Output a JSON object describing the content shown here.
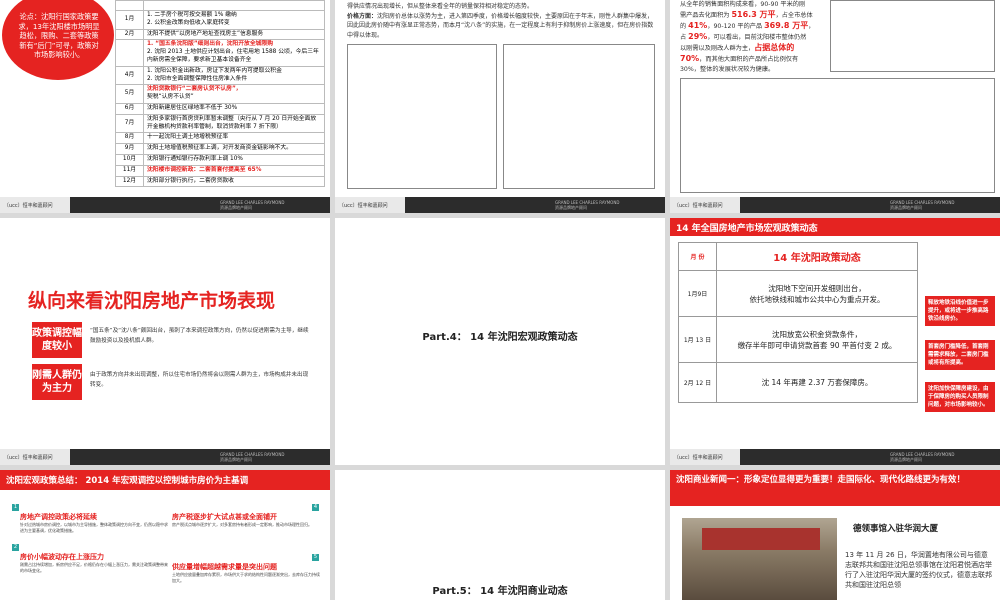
{
  "slide1": {
    "oval_text": "论点：沈阳行国家政策要求，13年沈阳楼市场明显趋松，限购、二套等政策新有“后门”可寻，政策对市场影响较小。",
    "rows": [
      {
        "month": "",
        "text": ""
      },
      {
        "month": "1月",
        "text": "1. 二手房个税可按交易额 1% 缴纳\n2. 公积金改策向低收入家庭转变"
      },
      {
        "month": "2月",
        "text": "沈阳不提供“以房地产地址查找房主”信息服务"
      },
      {
        "month": "",
        "text_red": "1. “国五条沈阳版”细则出台，沈阳开放全城限购",
        "text": "2. 沈阳 2013 土地供应计划出台，住宅用地 1588 公顷，今后三年内新房需全保障，要求新卫基本设备齐全"
      },
      {
        "month": "4月",
        "text": "1. 沈阳公积金出新政，房证下发两年内可提取公积金\n2. 沈阳市全面调整保障性住房准入条件"
      },
      {
        "month": "5月",
        "text_red": "沈阳贷款银行“二套房认贷不认房”，",
        "text": "契税“认房不认贷”"
      },
      {
        "month": "6月",
        "text": "沈阳新建居住区绿地率不低于 30%"
      },
      {
        "month": "7月",
        "text": "沈阳多家银行首房贷利率暂未调整（央行从 7 月 20 日开始全面放开金融机构贷款利率管制，取消贷款利率 7 折下限）"
      },
      {
        "month": "8月",
        "text": "十一起沈阳土调土地增税预征率"
      },
      {
        "month": "9月",
        "text": "沈阳土地增值税预征率上调，对开发商资金链影响不大。"
      },
      {
        "month": "10月",
        "text": "沈阳银行通知银行存款利率上调 10%"
      },
      {
        "month": "11月",
        "text_red": "沈阳楼市调控新政：二套首套付提高至 65%",
        "text": ""
      },
      {
        "month": "12月",
        "text": "沈阳部分银行执行，二套房贷款收"
      }
    ],
    "footer_logo": "〔ucc〕恒丰和嘉顾问",
    "footer_tag": "GRAND LEE CHARLES RAYMOND\n资源品牌地产顾问"
  },
  "slide2": {
    "para1": "得供应情况出现增长，但从整体来看全年的销量保持相对稳定的态势。",
    "label": "价格方面：",
    "para2": "沈阳房价总体以涨势为主，进入第四季度，价格增长幅度较快，主要原因在于年末，刚性人群集中爆发，因此因此房价随中有涨显正常态势，而本月“沈八条”的实施，在一定程度上有利于抑制房价上涨速度，但在房价指数中得以体现。",
    "footer_logo": "〔ucc〕恒丰和嘉顾问",
    "footer_tag": "GRAND LEE CHARLES RAYMOND\n资源品牌地产顾问"
  },
  "slide3": {
    "line1": "从全年的销售面积构成来看，90-90 平米的刚",
    "line2a": "需产品去化面积为 ",
    "v1": "516.3 万平",
    "line2b": "，占全市总体",
    "line3a": "的 ",
    "v2": "41%",
    "line3b": "，90-120 平的产品 ",
    "v3": "369.8 万平",
    "line3c": "，",
    "line4a": "占 ",
    "v4": "29%",
    "line4b": "，可以看出，目前沈阳楼市整体仍然",
    "line5a": "以刚需以及刚改人群为主，",
    "v5": "占据总体的",
    "v6": "70%",
    "line6b": "，而其他大面积的产品所占比例仅有",
    "line7": "30%，整体的发展状况较为健康。",
    "footer_logo": "〔ucc〕恒丰和嘉顾问",
    "footer_tag": "GRAND LEE CHARLES RAYMOND\n资源品牌地产顾问"
  },
  "slide4": {
    "title": "纵向来看沈阳房地产市场表现",
    "label1": "政策调控幅度较小",
    "desc1": "“国五条”及“沈八条”颇回出台，虽刺了本来调控政策方向，仍然以促进刚需为主导，继续鼓励投资以及投机旗人群。",
    "label2": "刚需人群仍为主力",
    "desc2": "由于政策方向并未出现调整，所以住宅市场仍然将会以刚需人群为主，市场构成并未出现转变。",
    "footer_logo": "〔ucc〕恒丰和嘉顾问",
    "footer_tag": "GRAND LEE CHARLES RAYMOND\n资源品牌地产顾问"
  },
  "slide5": {
    "title": "Part.4：  14 年沈阳宏观政策动态"
  },
  "slide6": {
    "header": "14 年全国房地产市场宏观政策动态",
    "col_month": "月 份",
    "col_title": "14 年沈阳政策动态",
    "rows": [
      {
        "month": "1月9日",
        "text": "沈阳地下空间开发细则出台，\n依托地铁线和城市公共中心为重点开发。"
      },
      {
        "month": "1月 13 日",
        "text": "沈阳放宽公积金贷款条件，\n缴存半年即可申请贷款首套 90 平首付变 2 成。"
      },
      {
        "month": "2月 12 日",
        "text": "沈 14 年再建 2.37 万套保障房。"
      }
    ],
    "notes": [
      "释放地铁沿线价值进一步提升，或将进一步推高路铁沿线房价。",
      "首套房门槛降低，首套刚需需求释放，二套房门槛或将有所提高。",
      "沈阳加快保障房建设，由于保障房的购买人员限制问题，对市场影响较小。"
    ],
    "footer_logo": "〔ucc〕恒丰和嘉顾问",
    "footer_tag": "GRAND LEE CHARLES RAYMOND\n资源品牌地产顾问"
  },
  "slide7": {
    "header": "沈阳宏观政策总结：  2014 年宏观调控以控制城市房价为主基调",
    "items": [
      {
        "num": "1",
        "title": "房地产调控政策必将延续",
        "text": "针对过热城市房价调控，以城市为主导措施，整体政策调控方向不变，仍然以稳中求进为主要基调，优化政策措施。"
      },
      {
        "num": "2",
        "title": "房价小幅波动存在上涨压力",
        "text": "刚需占比持续增加，新房供应不足，价格仍存在小幅上涨压力，需关注政策调整带来的市场变化。"
      },
      {
        "num": "4",
        "title": "房产税逐步扩大试点甚或全面铺开",
        "text": "房产税试点城市逐步扩大，对多套房持有者形成一定影响，推动市场理性回归。"
      },
      {
        "num": "5",
        "title": "供应量增幅超越需求量是突出问题",
        "text": "土地供应放量叠加库存累积，市场供大于求的结构性问题逐渐突出，去库存压力持续加大。"
      }
    ]
  },
  "slide8": {
    "title": "Part.5：  14 年沈阳商业动态"
  },
  "slide9": {
    "header": "沈阳商业新闻一：形象定位显得更为重要！走国际化、现代化路线更为有效！",
    "news_title": "德领事馆入驻华润大厦",
    "news_text": "13 年 11 月 26 日，华润置地有限公司与德意志联邦共和国驻沈阳总领事馆在沈阳君悦酒店举行了入驻沈阳华润大厦的签约仪式，德意志联邦共和国驻沈阳总领"
  }
}
